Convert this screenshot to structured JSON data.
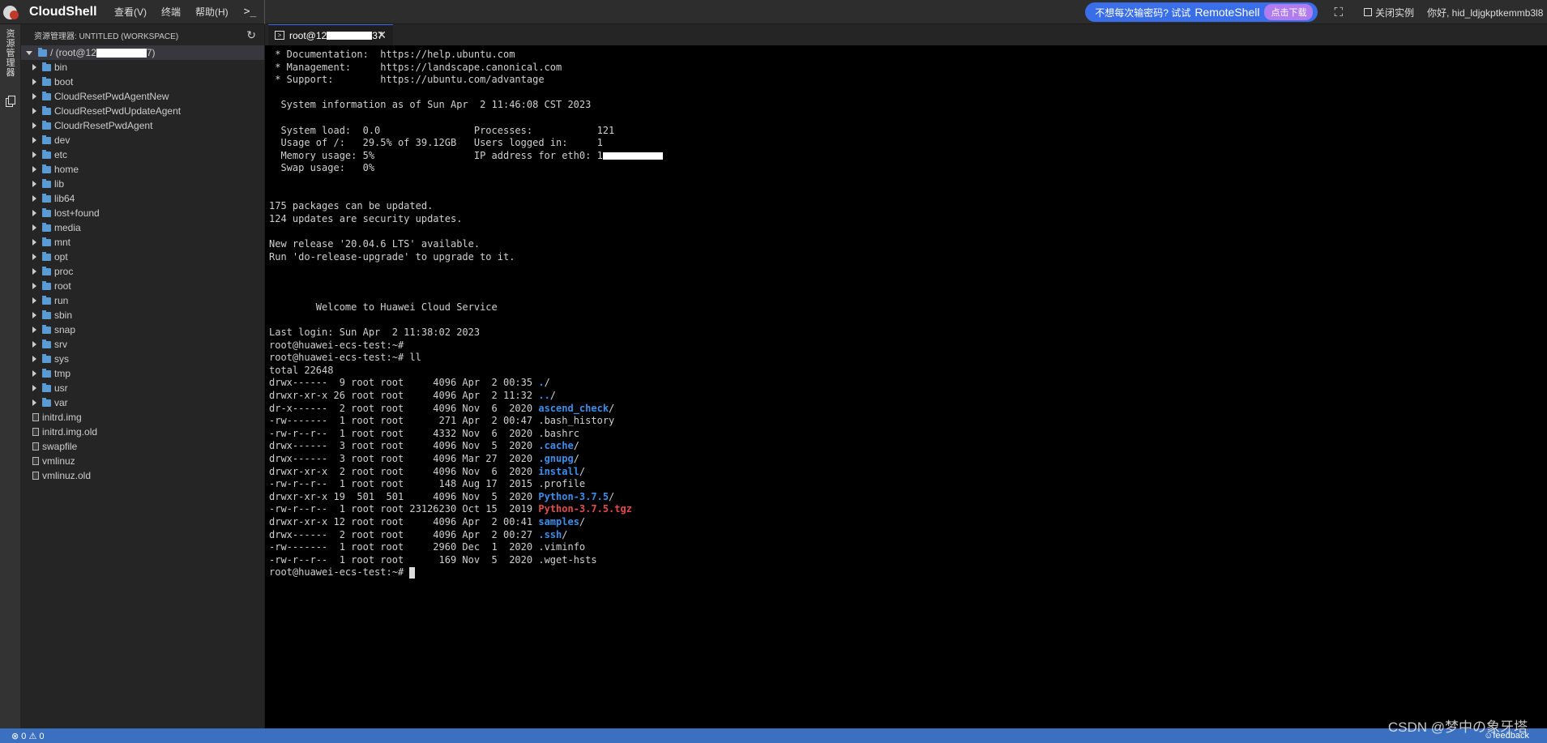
{
  "topbar": {
    "logo_text": "CloudShell",
    "menu": [
      "查看(V)",
      "终端",
      "帮助(H)"
    ],
    "terminal_glyph": ">_",
    "promo_text": "不想每次输密码? 试试",
    "promo_brand": "RemoteShell",
    "promo_button": "点击下载",
    "close_instance": "关闭实例",
    "greeting": "你好, hid_ldjgkptkemmb3l8"
  },
  "activity": {
    "label": "资源管理器"
  },
  "explorer": {
    "title": "资源管理器: UNTITLED (WORKSPACE)",
    "root_prefix": "/ (root@12",
    "root_suffix": "7)",
    "folders": [
      "bin",
      "boot",
      "CloudResetPwdAgentNew",
      "CloudResetPwdUpdateAgent",
      "CloudrResetPwdAgent",
      "dev",
      "etc",
      "home",
      "lib",
      "lib64",
      "lost+found",
      "media",
      "mnt",
      "opt",
      "proc",
      "root",
      "run",
      "sbin",
      "snap",
      "srv",
      "sys",
      "tmp",
      "usr",
      "var"
    ],
    "files": [
      "initrd.img",
      "initrd.img.old",
      "swapfile",
      "vmlinuz",
      "vmlinuz.old"
    ]
  },
  "tab": {
    "prefix": "root@12",
    "suffix": "37"
  },
  "terminal": {
    "lines": [
      " * Documentation:  https://help.ubuntu.com",
      " * Management:     https://landscape.canonical.com",
      " * Support:        https://ubuntu.com/advantage",
      "",
      "  System information as of Sun Apr  2 11:46:08 CST 2023",
      "",
      "  System load:  0.0                Processes:           121",
      "  Usage of /:   29.5% of 39.12GB   Users logged in:     1",
      "  Memory usage: 5%                 IP address for eth0: 1",
      "  Swap usage:   0%",
      "",
      "",
      "175 packages can be updated.",
      "124 updates are security updates.",
      "",
      "New release '20.04.6 LTS' available.",
      "Run 'do-release-upgrade' to upgrade to it.",
      "",
      "",
      "",
      "        Welcome to Huawei Cloud Service",
      "",
      "Last login: Sun Apr  2 11:38:02 2023",
      "root@huawei-ecs-test:~#",
      "root@huawei-ecs-test:~# ll",
      "total 22648"
    ],
    "listing": [
      {
        "meta": "drwx------  9 root root     4096 Apr  2 00:35 ",
        "name": ".",
        "suffix": "/",
        "color": "blue"
      },
      {
        "meta": "drwxr-xr-x 26 root root     4096 Apr  2 11:32 ",
        "name": "..",
        "suffix": "/",
        "color": "blue"
      },
      {
        "meta": "dr-x------  2 root root     4096 Nov  6  2020 ",
        "name": "ascend_check",
        "suffix": "/",
        "color": "blue"
      },
      {
        "meta": "-rw-------  1 root root      271 Apr  2 00:47 ",
        "name": ".bash_history",
        "suffix": "",
        "color": "plain"
      },
      {
        "meta": "-rw-r--r--  1 root root     4332 Nov  6  2020 ",
        "name": ".bashrc",
        "suffix": "",
        "color": "plain"
      },
      {
        "meta": "drwx------  3 root root     4096 Nov  5  2020 ",
        "name": ".cache",
        "suffix": "/",
        "color": "blue"
      },
      {
        "meta": "drwx------  3 root root     4096 Mar 27  2020 ",
        "name": ".gnupg",
        "suffix": "/",
        "color": "blue"
      },
      {
        "meta": "drwxr-xr-x  2 root root     4096 Nov  6  2020 ",
        "name": "install",
        "suffix": "/",
        "color": "blue"
      },
      {
        "meta": "-rw-r--r--  1 root root      148 Aug 17  2015 ",
        "name": ".profile",
        "suffix": "",
        "color": "plain"
      },
      {
        "meta": "drwxr-xr-x 19  501  501     4096 Nov  5  2020 ",
        "name": "Python-3.7.5",
        "suffix": "/",
        "color": "blue"
      },
      {
        "meta": "-rw-r--r--  1 root root 23126230 Oct 15  2019 ",
        "name": "Python-3.7.5.tgz",
        "suffix": "",
        "color": "red"
      },
      {
        "meta": "drwxr-xr-x 12 root root     4096 Apr  2 00:41 ",
        "name": "samples",
        "suffix": "/",
        "color": "blue"
      },
      {
        "meta": "drwx------  2 root root     4096 Apr  2 00:27 ",
        "name": ".ssh",
        "suffix": "/",
        "color": "blue"
      },
      {
        "meta": "-rw-------  1 root root     2960 Dec  1  2020 ",
        "name": ".viminfo",
        "suffix": "",
        "color": "plain"
      },
      {
        "meta": "-rw-r--r--  1 root root      169 Nov  5  2020 ",
        "name": ".wget-hsts",
        "suffix": "",
        "color": "plain"
      }
    ],
    "prompt": "root@huawei-ecs-test:~# "
  },
  "statusbar": {
    "problems": "⊗ 0 ⚠ 0",
    "feedback": "☺feedback"
  },
  "watermark": "CSDN @梦中の象牙塔"
}
